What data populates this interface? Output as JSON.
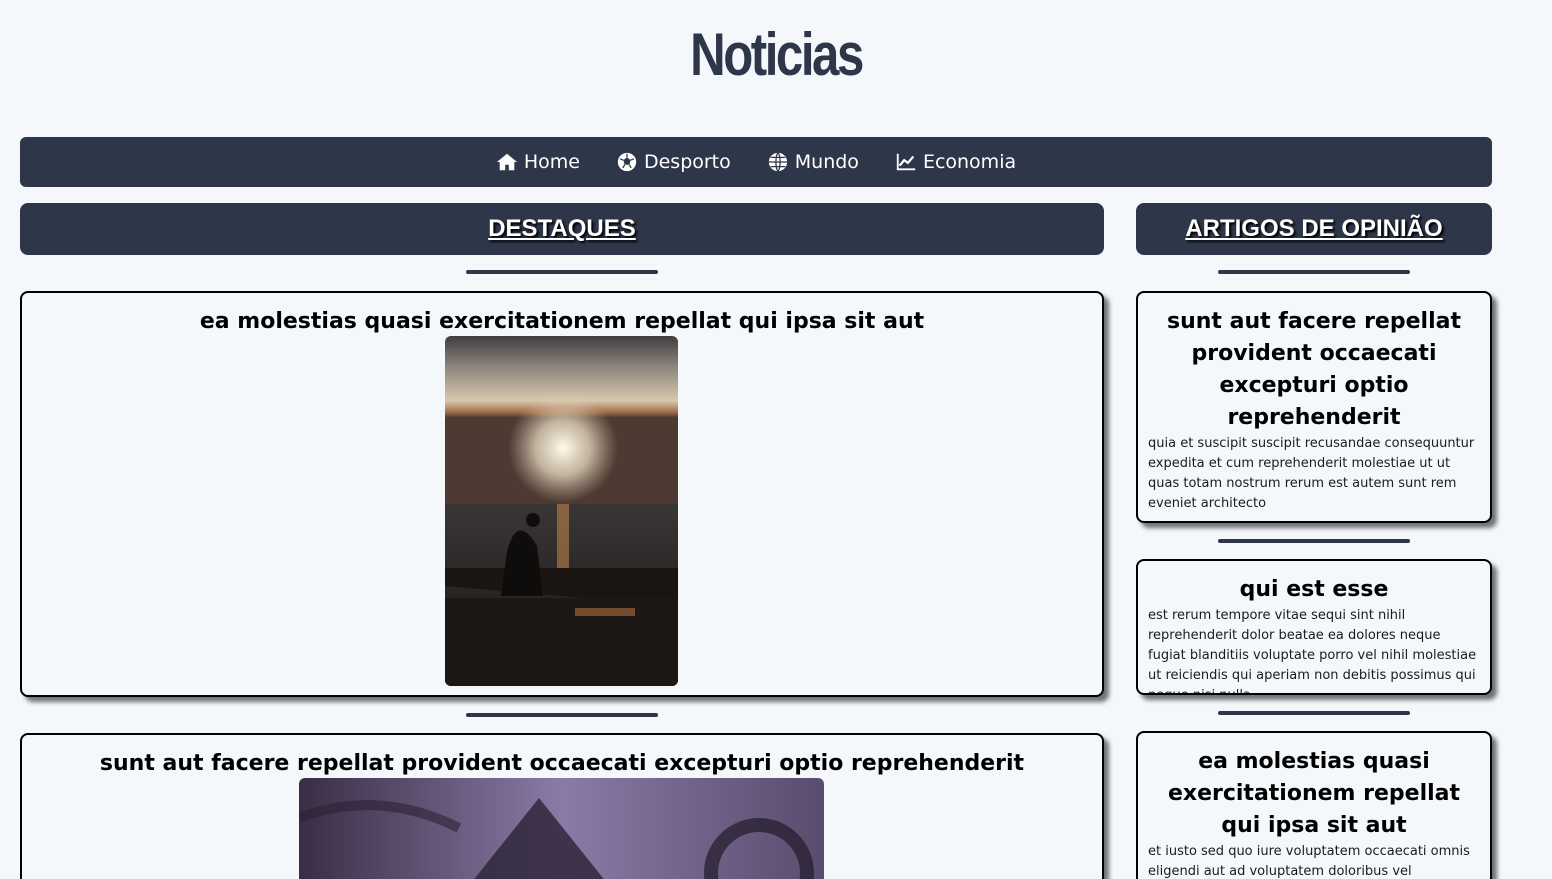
{
  "header": {
    "title": "Noticias"
  },
  "nav": {
    "items": [
      {
        "label": "Home",
        "icon": "home-icon"
      },
      {
        "label": "Desporto",
        "icon": "soccer-ball-icon"
      },
      {
        "label": "Mundo",
        "icon": "globe-icon"
      },
      {
        "label": "Economia",
        "icon": "line-chart-icon"
      }
    ]
  },
  "highlights": {
    "heading": "DESTAQUES",
    "articles": [
      {
        "title": "ea molestias quasi exercitationem repellat qui ipsa sit aut",
        "image": "sunset-sea-photo"
      },
      {
        "title": "sunt aut facere repellat provident occaecati excepturi optio reprehenderit",
        "image": "dollar-bill-photo"
      }
    ]
  },
  "opinion": {
    "heading": "ARTIGOS DE OPINIÃO",
    "articles": [
      {
        "title": "sunt aut facere repellat provident occaecati excepturi optio reprehenderit",
        "body": "quia et suscipit suscipit recusandae consequuntur expedita et cum reprehenderit molestiae ut ut quas totam nostrum rerum est autem sunt rem eveniet architecto"
      },
      {
        "title": "qui est esse",
        "body": "est rerum tempore vitae sequi sint nihil reprehenderit dolor beatae ea dolores neque fugiat blanditiis voluptate porro vel nihil molestiae ut reiciendis qui aperiam non debitis possimus qui neque nisi nulla"
      },
      {
        "title": "ea molestias quasi exercitationem repellat qui ipsa sit aut",
        "body": "et iusto sed quo iure voluptatem occaecati omnis eligendi aut ad voluptatem doloribus vel accusantium quis pariatur molestiae porro eius odio et labore et velit aut"
      }
    ]
  },
  "colors": {
    "primary": "#2e3649",
    "background": "#f4f8fb",
    "text": "#000000"
  }
}
